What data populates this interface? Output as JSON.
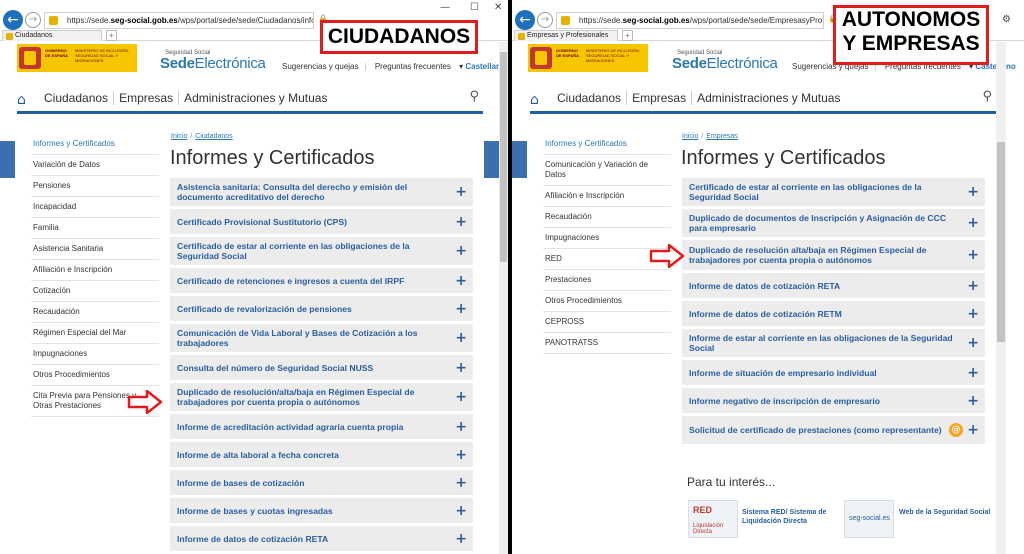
{
  "left": {
    "url_prefix": "https://sede.",
    "url_domain": "seg-social.gob.es",
    "url_rest": "/wps/portal/sede/sede/Ciudadanos/informes%20y%20c",
    "tab_title": "Ciudadanos",
    "breadcrumb": [
      "Inicio",
      "Ciudadanos"
    ],
    "page_title": "Informes y Certificados",
    "label": "CIUDADANOS",
    "menu": [
      "Informes y Certificados",
      "Variación de Datos",
      "Pensiones",
      "Incapacidad",
      "Familia",
      "Asistencia Sanitaria",
      "Afiliación e Inscripción",
      "Cotización",
      "Recaudación",
      "Régimen Especial del Mar",
      "Impugnaciones",
      "Otros Procedimientos",
      "Cita Previa para Pensiones y Otras Prestaciones"
    ],
    "items": [
      "Asistencia sanitaria: Consulta del derecho y emisión del documento acreditativo del derecho",
      "Certificado Provisional Sustitutorio (CPS)",
      "Certificado de estar al corriente en las obligaciones de la Seguridad Social",
      "Certificado de retenciones e ingresos a cuenta del IRPF",
      "Certificado de revalorización de pensiones",
      "Comunicación de Vida Laboral y Bases de Cotización a los trabajadores",
      "Consulta del número de Seguridad Social NUSS",
      "Duplicado de resolución/alta/baja en Régimen Especial de trabajadores por cuenta propia o autónomos",
      "Informe de acreditación actividad agraria cuenta propia",
      "Informe de alta laboral a fecha concreta",
      "Informe de bases de cotización",
      "Informe de bases y cuotas ingresadas",
      "Informe de datos de cotización RETA"
    ]
  },
  "right": {
    "url_prefix": "https://sede.",
    "url_domain": "seg-social.gob.es",
    "url_rest": "/wps/portal/sede/sede/EmpresasyProfesionales/informe",
    "tab_title": "Empresas y Profesionales",
    "breadcrumb": [
      "Inicio",
      "Empresas"
    ],
    "page_title": "Informes y Certificados",
    "label_line1": "AUTONOMOS",
    "label_line2": "Y EMPRESAS",
    "menu": [
      "Informes y Certificados",
      "Comunicación y Variación de Datos",
      "Afiliación e Inscripción",
      "Recaudación",
      "Impugnaciones",
      "RED",
      "Prestaciones",
      "Otros Procedimientos",
      "CEPROSS",
      "PANOTRATSS"
    ],
    "items": [
      "Certificado de estar al corriente en las obligaciones de la Seguridad Social",
      "Duplicado de documentos de Inscripción y Asignación de CCC para empresario",
      "Duplicado de resolución alta/baja en Régimen Especial de trabajadores por cuenta propia o autónomos",
      "Informe de datos de cotización RETA",
      "Informe de datos de cotización RETM",
      "Informe de estar al corriente en las obligaciones de la Seguridad Social",
      "Informe de situación de empresario individual",
      "Informe negativo de inscripción de empresario",
      "Solicitud de certificado de prestaciones (como representante)"
    ],
    "interest_title": "Para tu interés...",
    "interest_links": [
      "Sistema RED/ Sistema de Liquidación Directa",
      "Web de la Seguridad Social"
    ],
    "interest_logos": [
      "RED",
      "Liquidación Directa",
      "seg-social.es"
    ]
  },
  "common": {
    "site_small": "Seguridad Social",
    "site_big_bold": "Sede",
    "site_big_rest": "Electrónica",
    "gov_text": "GOBIERNO DE ESPAÑA",
    "ministry_text": "MINISTERIO DE INCLUSIÓN, SEGURIDAD SOCIAL Y MIGRACIONES",
    "top_links": [
      "Sugerencias y quejas",
      "Preguntas frecuentes"
    ],
    "lang": "Castellano",
    "nav": [
      "Ciudadanos",
      "Empresas",
      "Administraciones y Mutuas"
    ],
    "icons": {
      "home": "home-icon",
      "search": "search-icon",
      "plus": "plus-icon",
      "help": "help-icon",
      "back": "back-arrow-icon"
    },
    "colors": {
      "link": "#2a5d9f",
      "brand": "#2a77b6",
      "label_border": "#e31b1b",
      "nav_bar": "#1e5fa6"
    }
  }
}
